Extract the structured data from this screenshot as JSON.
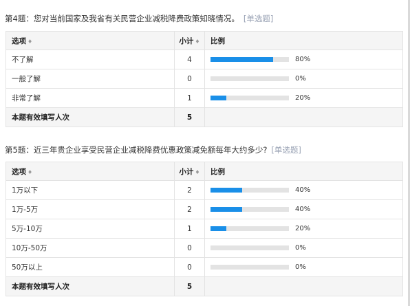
{
  "questions": [
    {
      "title": "第4题：您对当前国家及我省有关民营企业减税降费政策知晓情况。",
      "tag": "[单选题]",
      "headers": {
        "option": "选项",
        "count": "小计",
        "ratio": "比例"
      },
      "rows": [
        {
          "option": "不了解",
          "count": "4",
          "percent": 80,
          "pct_label": "80%"
        },
        {
          "option": "一般了解",
          "count": "0",
          "percent": 0,
          "pct_label": "0%"
        },
        {
          "option": "非常了解",
          "count": "1",
          "percent": 20,
          "pct_label": "20%"
        }
      ],
      "total_label": "本题有效填写人次",
      "total_count": "5"
    },
    {
      "title": "第5题：近三年贵企业享受民营企业减税降费优惠政策减免额每年大约多少?",
      "tag": "[单选题]",
      "headers": {
        "option": "选项",
        "count": "小计",
        "ratio": "比例"
      },
      "rows": [
        {
          "option": "1万以下",
          "count": "2",
          "percent": 40,
          "pct_label": "40%"
        },
        {
          "option": "1万-5万",
          "count": "2",
          "percent": 40,
          "pct_label": "40%"
        },
        {
          "option": "5万-10万",
          "count": "1",
          "percent": 20,
          "pct_label": "20%"
        },
        {
          "option": "10万-50万",
          "count": "0",
          "percent": 0,
          "pct_label": "0%"
        },
        {
          "option": "50万以上",
          "count": "0",
          "percent": 0,
          "pct_label": "0%"
        }
      ],
      "total_label": "本题有效填写人次",
      "total_count": "5"
    }
  ],
  "colors": {
    "bar_fill": "#1a8fe8",
    "bar_track": "#e3e3e3",
    "header_bg": "#f5f5f5",
    "tag": "#9aa3b5"
  },
  "icons": {
    "sort": "sort-arrows-icon"
  }
}
